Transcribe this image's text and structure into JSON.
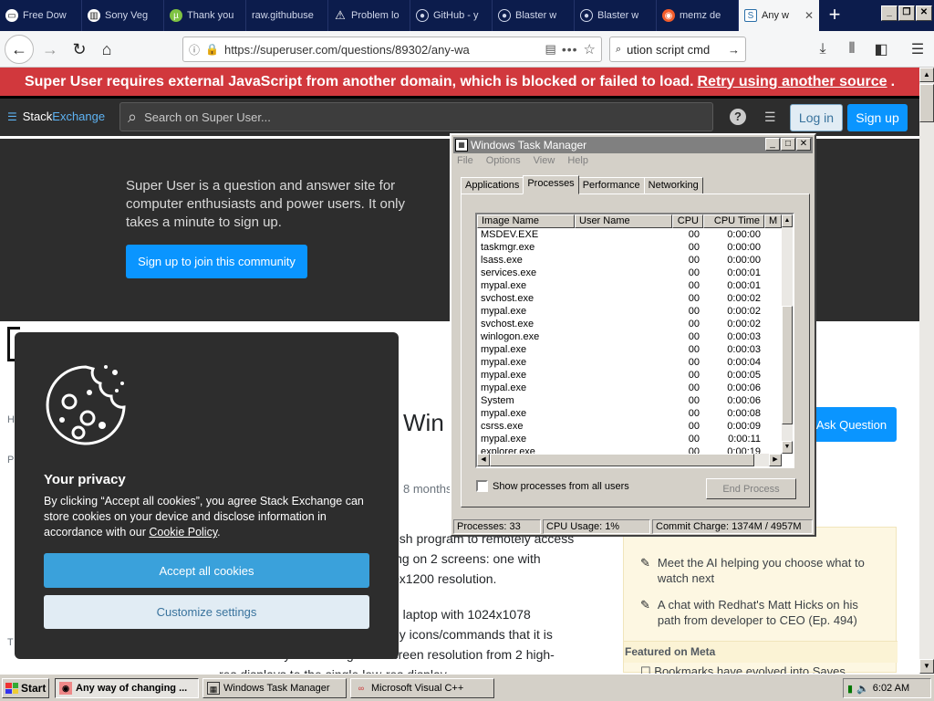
{
  "browser": {
    "tabs": [
      {
        "title": "Free Dow",
        "icon": "page-icon"
      },
      {
        "title": "Sony Veg",
        "icon": "building-icon"
      },
      {
        "title": "Thank you",
        "icon": "utorrent-icon"
      },
      {
        "title": "raw.githubuse",
        "icon": "blank-icon"
      },
      {
        "title": "Problem lo",
        "icon": "warning-icon"
      },
      {
        "title": "GitHub - y",
        "icon": "github-icon"
      },
      {
        "title": "Blaster w",
        "icon": "github-icon"
      },
      {
        "title": "Blaster w",
        "icon": "github-icon"
      },
      {
        "title": "memz de",
        "icon": "brand-icon"
      },
      {
        "title": "Any w",
        "icon": "superuser-icon"
      }
    ],
    "new_tab": "+",
    "url": "https://superuser.com/questions/89302/any-wa",
    "search_text": "ution script cmd"
  },
  "page": {
    "js_banner": "Super User requires external JavaScript from another domain, which is blocked or failed to load.",
    "js_banner_link": "Retry using another source",
    "logo_stack": "Stack",
    "logo_exchange": "Exchange",
    "search_placeholder": "Search on Super User...",
    "login": "Log in",
    "signup": "Sign up",
    "hero_text": "Super User is a question and answer site for computer enthusiasts and power users. It only takes a minute to sign up.",
    "hero_button": "Sign up to join this community",
    "title_partial": "Win",
    "ask_question": "Ask Question",
    "asked_partial": "8 months",
    "body_lines_1": [
      "esh program to remotely access",
      "ing on 2 screens: one with",
      "0x1200 resolution."
    ],
    "body_lines_2": [
      "d laptop with 1024x1078",
      "ny icons/commands that it is",
      "difficult to try and change the screen resolution from 2 high-",
      "res displays to the single low-res display."
    ],
    "sidebar_items": [
      "Meet the AI helping you choose what to watch next",
      "A chat with Redhat's Matt Hicks on his path from developer to CEO (Ep. 494)"
    ],
    "featured_meta": "Featured on Meta",
    "meta_item": "Bookmarks have evolved into Saves"
  },
  "cookie": {
    "heading": "Your privacy",
    "text": "By clicking “Accept all cookies”, you agree Stack Exchange can store cookies on your device and disclose information in accordance with our",
    "policy_link": "Cookie Policy",
    "accept": "Accept all cookies",
    "customize": "Customize settings"
  },
  "taskmanager": {
    "title": "Windows Task Manager",
    "menu": [
      "File",
      "Options",
      "View",
      "Help"
    ],
    "tabs": [
      "Applications",
      "Processes",
      "Performance",
      "Networking"
    ],
    "selected_tab": "Processes",
    "columns": [
      "Image Name",
      "User Name",
      "CPU",
      "CPU Time",
      "M"
    ],
    "processes": [
      {
        "name": "MSDEV.EXE",
        "user": "",
        "cpu": "00",
        "time": "0:00:00"
      },
      {
        "name": "taskmgr.exe",
        "user": "",
        "cpu": "00",
        "time": "0:00:00"
      },
      {
        "name": "lsass.exe",
        "user": "",
        "cpu": "00",
        "time": "0:00:00"
      },
      {
        "name": "services.exe",
        "user": "",
        "cpu": "00",
        "time": "0:00:01"
      },
      {
        "name": "mypal.exe",
        "user": "",
        "cpu": "00",
        "time": "0:00:01"
      },
      {
        "name": "svchost.exe",
        "user": "",
        "cpu": "00",
        "time": "0:00:02"
      },
      {
        "name": "mypal.exe",
        "user": "",
        "cpu": "00",
        "time": "0:00:02"
      },
      {
        "name": "svchost.exe",
        "user": "",
        "cpu": "00",
        "time": "0:00:02"
      },
      {
        "name": "winlogon.exe",
        "user": "",
        "cpu": "00",
        "time": "0:00:03"
      },
      {
        "name": "mypal.exe",
        "user": "",
        "cpu": "00",
        "time": "0:00:03"
      },
      {
        "name": "mypal.exe",
        "user": "",
        "cpu": "00",
        "time": "0:00:04"
      },
      {
        "name": "mypal.exe",
        "user": "",
        "cpu": "00",
        "time": "0:00:05"
      },
      {
        "name": "mypal.exe",
        "user": "",
        "cpu": "00",
        "time": "0:00:06"
      },
      {
        "name": "System",
        "user": "",
        "cpu": "00",
        "time": "0:00:06"
      },
      {
        "name": "mypal.exe",
        "user": "",
        "cpu": "00",
        "time": "0:00:08"
      },
      {
        "name": "csrss.exe",
        "user": "",
        "cpu": "00",
        "time": "0:00:09"
      },
      {
        "name": "mypal.exe",
        "user": "",
        "cpu": "00",
        "time": "0:00:11"
      },
      {
        "name": "explorer.exe",
        "user": "",
        "cpu": "00",
        "time": "0:00:19"
      }
    ],
    "show_all": "Show processes from all users",
    "end_process": "End Process",
    "status_processes": "Processes: 33",
    "status_cpu": "CPU Usage: 1%",
    "status_commit": "Commit Charge: 1374M / 4957M"
  },
  "taskbar": {
    "start": "Start",
    "tasks": [
      "Any way of changing ...",
      "Windows Task Manager",
      "Microsoft Visual C++"
    ],
    "clock": "6:02 AM"
  },
  "colors": {
    "banner": "#d1383d",
    "accent_blue": "#0a95ff",
    "dark_header": "#2d2d2d",
    "win_face": "#d4d0c8"
  }
}
